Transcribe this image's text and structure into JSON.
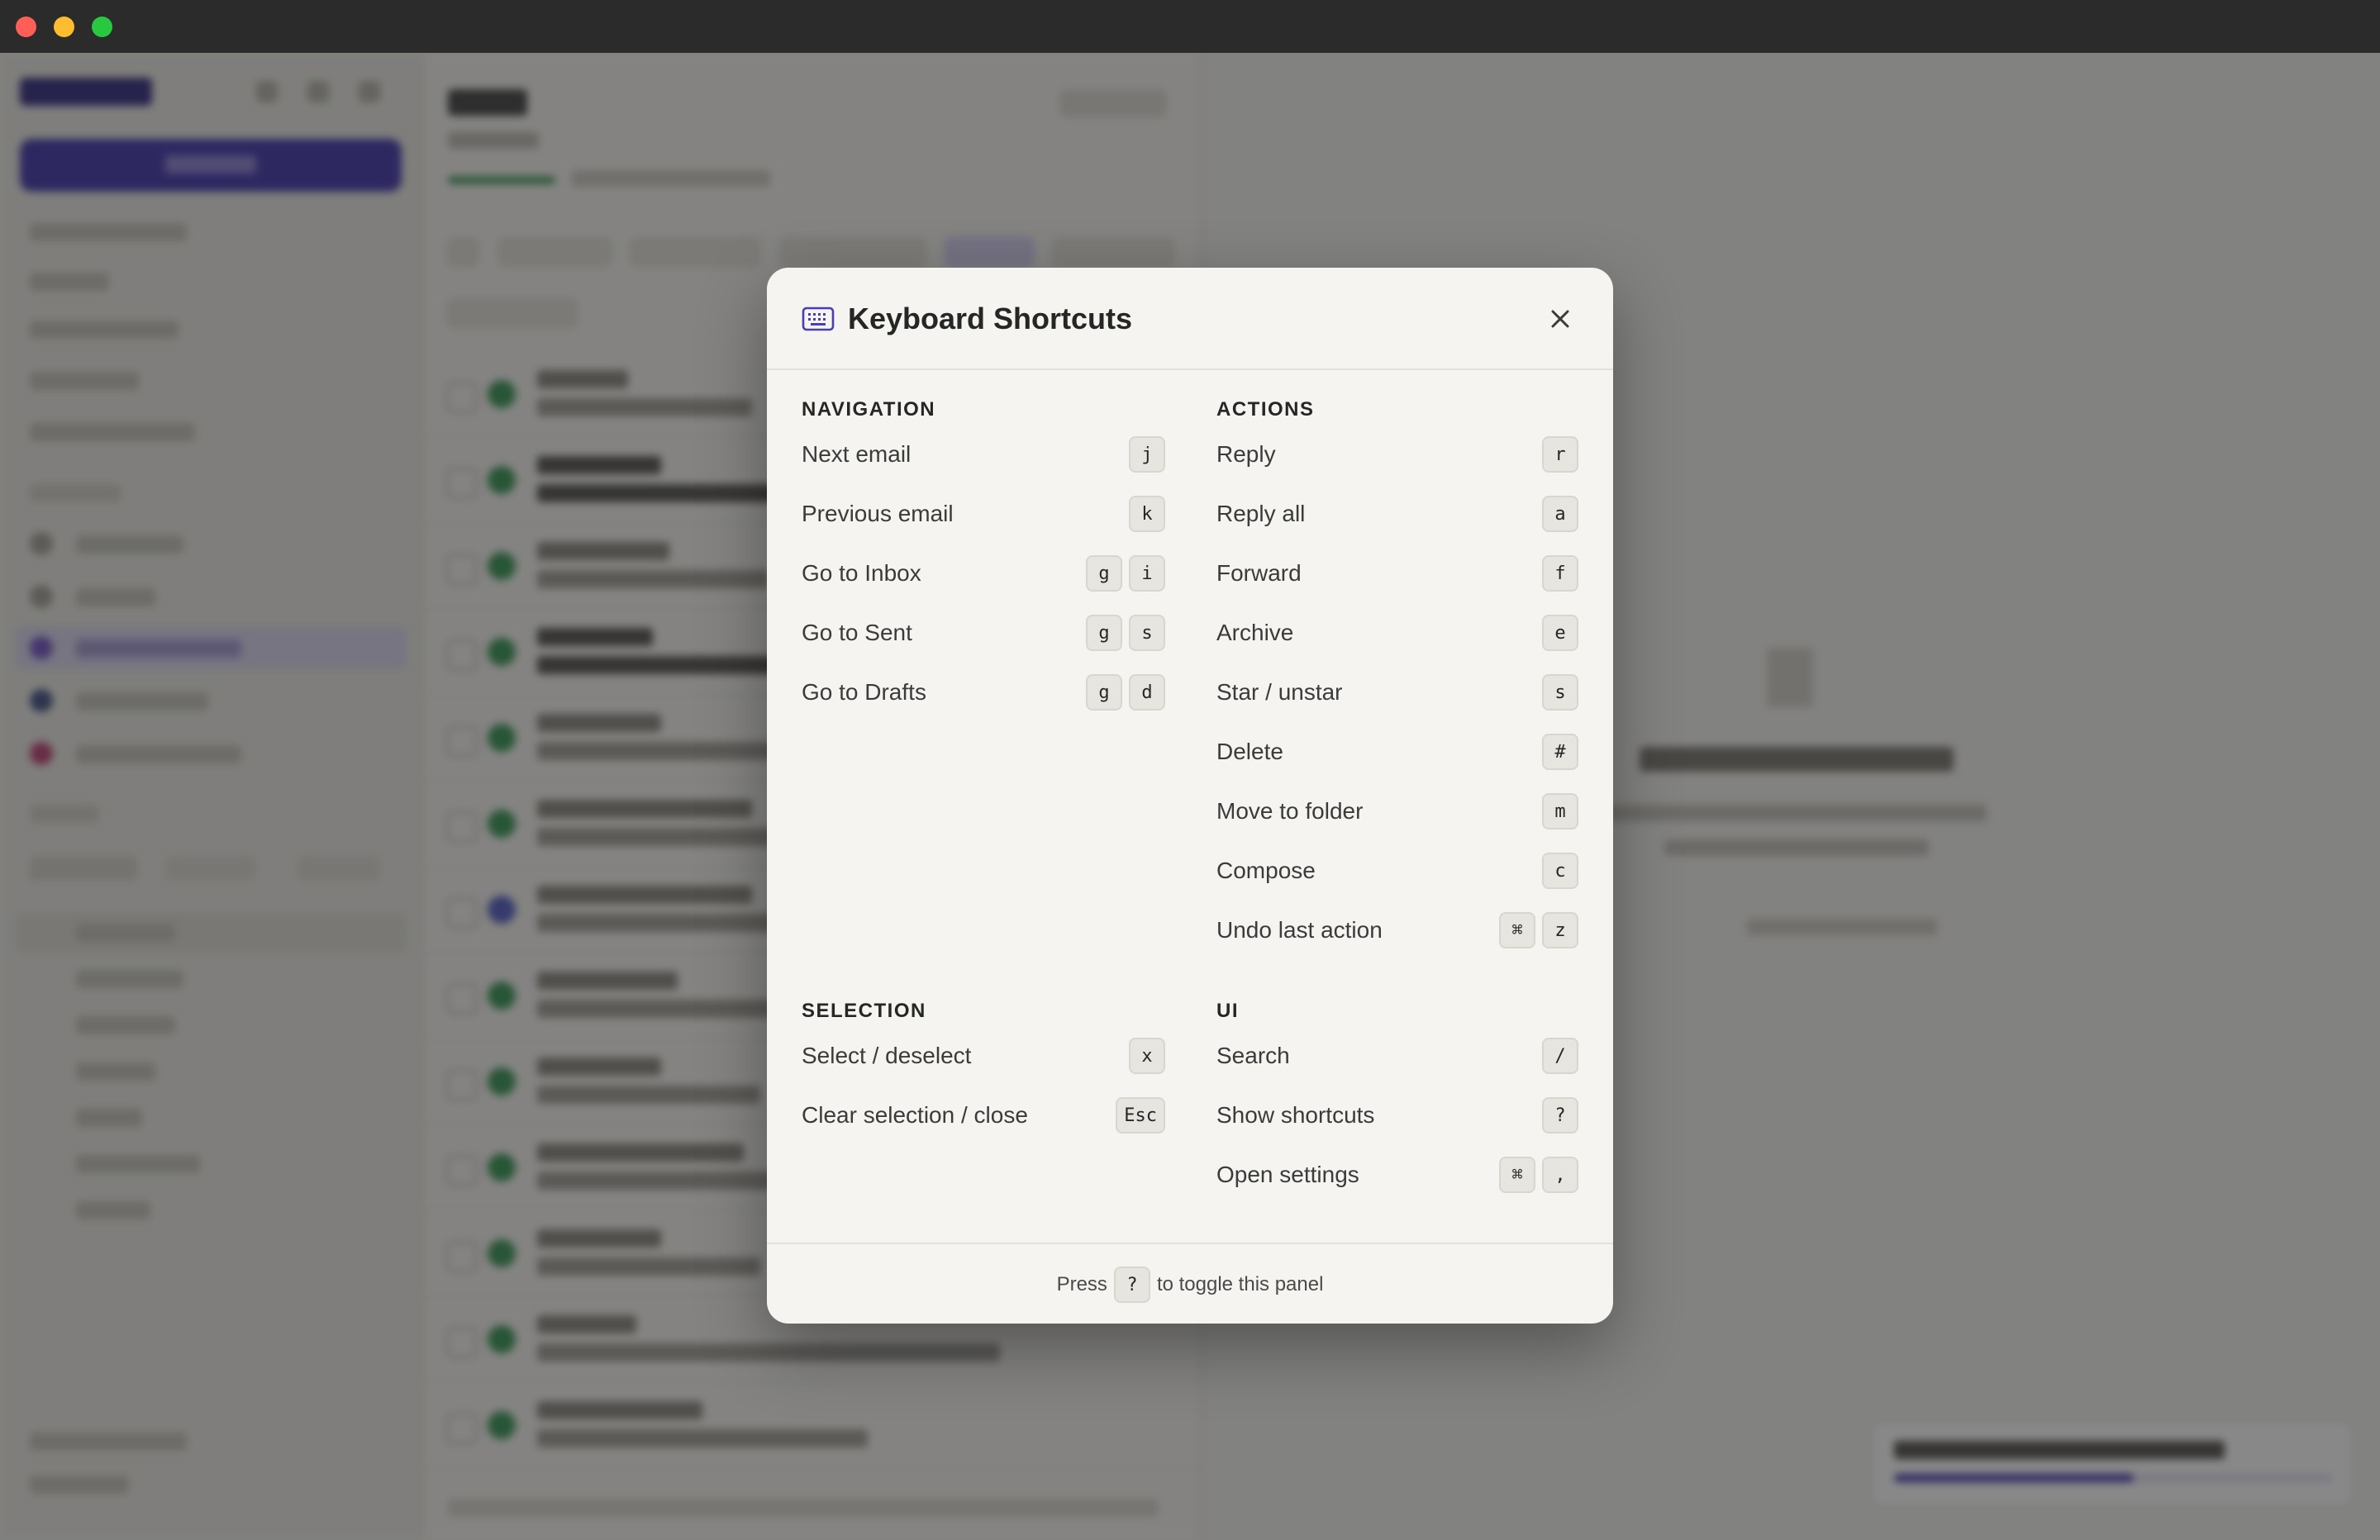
{
  "window": {
    "controls": [
      "close",
      "minimize",
      "zoom"
    ]
  },
  "modal": {
    "title": "Keyboard Shortcuts",
    "icon": "keyboard-icon",
    "close_icon": "close-icon",
    "sections": {
      "navigation": {
        "title": "NAVIGATION",
        "items": [
          {
            "label": "Next email",
            "keys": [
              "j"
            ]
          },
          {
            "label": "Previous email",
            "keys": [
              "k"
            ]
          },
          {
            "label": "Go to Inbox",
            "keys": [
              "g",
              "i"
            ]
          },
          {
            "label": "Go to Sent",
            "keys": [
              "g",
              "s"
            ]
          },
          {
            "label": "Go to Drafts",
            "keys": [
              "g",
              "d"
            ]
          }
        ]
      },
      "actions": {
        "title": "ACTIONS",
        "items": [
          {
            "label": "Reply",
            "keys": [
              "r"
            ]
          },
          {
            "label": "Reply all",
            "keys": [
              "a"
            ]
          },
          {
            "label": "Forward",
            "keys": [
              "f"
            ]
          },
          {
            "label": "Archive",
            "keys": [
              "e"
            ]
          },
          {
            "label": "Star / unstar",
            "keys": [
              "s"
            ]
          },
          {
            "label": "Delete",
            "keys": [
              "#"
            ]
          },
          {
            "label": "Move to folder",
            "keys": [
              "m"
            ]
          },
          {
            "label": "Compose",
            "keys": [
              "c"
            ]
          },
          {
            "label": "Undo last action",
            "keys": [
              "⌘",
              "z"
            ]
          }
        ]
      },
      "selection": {
        "title": "SELECTION",
        "items": [
          {
            "label": "Select / deselect",
            "keys": [
              "x"
            ]
          },
          {
            "label": "Clear selection / close",
            "keys": [
              "Esc"
            ]
          }
        ]
      },
      "ui": {
        "title": "UI",
        "items": [
          {
            "label": "Search",
            "keys": [
              "/"
            ]
          },
          {
            "label": "Show shortcuts",
            "keys": [
              "?"
            ]
          },
          {
            "label": "Open settings",
            "keys": [
              "⌘",
              ","
            ]
          }
        ]
      }
    },
    "footer": {
      "prefix": "Press",
      "key": "?",
      "suffix": "to toggle this panel"
    }
  },
  "colors": {
    "accent": "#4a3fb0",
    "modal_bg": "#f5f4f0",
    "overlay": "rgba(18,18,18,0.50)"
  }
}
